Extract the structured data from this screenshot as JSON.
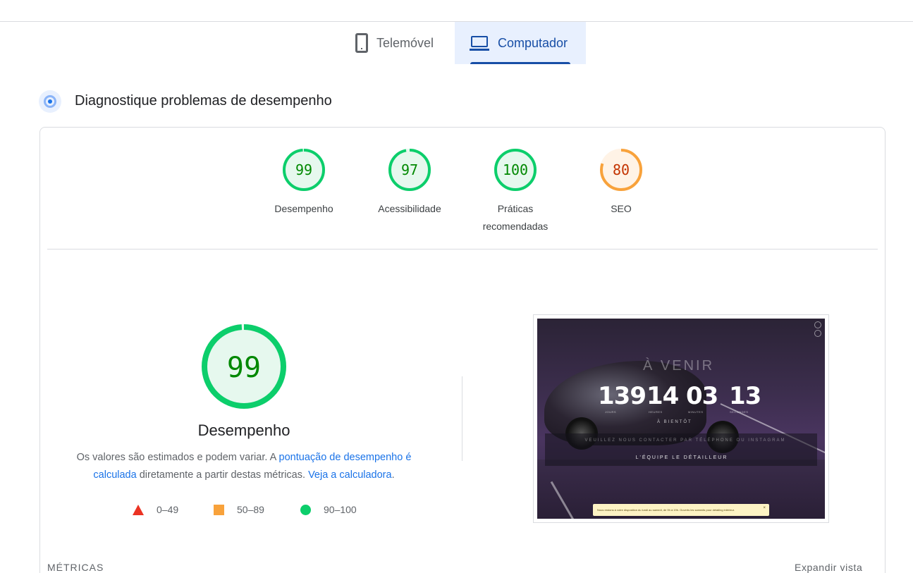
{
  "tabs": [
    {
      "label": "Telemóvel",
      "icon": "phone-icon",
      "selected": false
    },
    {
      "label": "Computador",
      "icon": "laptop-icon",
      "selected": true
    }
  ],
  "section": {
    "title": "Diagnostique problemas de desempenho",
    "icon": "diagnose-icon"
  },
  "scores": [
    {
      "label": "Desempenho",
      "value": 99,
      "color": "#0cce6b",
      "text_color": "#008800",
      "fill": "#e6f8ee"
    },
    {
      "label": "Acessibilidade",
      "value": 97,
      "color": "#0cce6b",
      "text_color": "#008800",
      "fill": "#e6f8ee"
    },
    {
      "label_line1": "Práticas",
      "label_line2": "recomendadas",
      "value": 100,
      "color": "#0cce6b",
      "text_color": "#008800",
      "fill": "#e6f8ee"
    },
    {
      "label": "SEO",
      "value": 80,
      "color": "#f8a23b",
      "text_color": "#c33300",
      "fill": "#fff3e6"
    }
  ],
  "main_score": {
    "value": 99,
    "title": "Desempenho",
    "color": "#0cce6b",
    "text_color": "#008800"
  },
  "description": {
    "part1": "Os valores são estimados e podem variar. A ",
    "link1": "pontuação de desempenho é calculada",
    "part2": " diretamente a partir destas métricas. ",
    "link2": "Veja a calculadora",
    "part3": "."
  },
  "legend": [
    {
      "range": "0–49",
      "shape": "triangle",
      "color": "#eb3323"
    },
    {
      "range": "50–89",
      "shape": "square",
      "color": "#f8a23b"
    },
    {
      "range": "90–100",
      "shape": "circle",
      "color": "#0cce6b"
    }
  ],
  "screenshot": {
    "heading": "À VENIR",
    "counters": [
      "139",
      "14",
      "03",
      "13"
    ],
    "counter_captions": [
      "JOURS",
      "HEURES",
      "MINUTES",
      "SECONDES"
    ],
    "subtitle": "À BIENTÔT",
    "message": "VEUILLEZ NOUS CONTACTER PAR TÉLÉPHONE OU INSTAGRAM",
    "signature": "L'ÉQUIPE LE DÉTAILLEUR",
    "notice": "Nous restons à votre disposition du lundi au samedi, de 9h à 19h. Ouverts les samedis pour detailing intérieur.",
    "notice_close": "×"
  },
  "footer": {
    "metrics_label": "MÉTRICAS",
    "expand_label": "Expandir vista"
  }
}
